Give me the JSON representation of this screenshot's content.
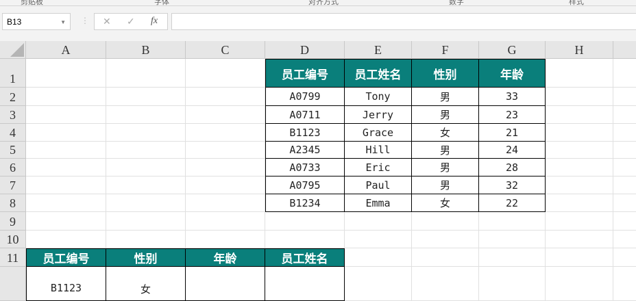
{
  "ribbon": {
    "groups": [
      "剪贴板",
      "字体",
      "对齐方式",
      "数字",
      "样式"
    ]
  },
  "formula_bar": {
    "name_box": "B13",
    "cancel": "✕",
    "confirm": "✓",
    "fx": "fx",
    "formula": ""
  },
  "columns": [
    "A",
    "B",
    "C",
    "D",
    "E",
    "F",
    "G",
    "H"
  ],
  "rows": [
    "1",
    "2",
    "3",
    "4",
    "5",
    "6",
    "7",
    "8",
    "9",
    "10",
    "11"
  ],
  "table1": {
    "headers": [
      "员工编号",
      "员工姓名",
      "性别",
      "年龄"
    ],
    "rows": [
      [
        "A0799",
        "Tony",
        "男",
        "33"
      ],
      [
        "A0711",
        "Jerry",
        "男",
        "23"
      ],
      [
        "B1123",
        "Grace",
        "女",
        "21"
      ],
      [
        "A2345",
        "Hill",
        "男",
        "24"
      ],
      [
        "A0733",
        "Eric",
        "男",
        "28"
      ],
      [
        "A0795",
        "Paul",
        "男",
        "32"
      ],
      [
        "B1234",
        "Emma",
        "女",
        "22"
      ]
    ]
  },
  "table2": {
    "headers": [
      "员工编号",
      "性别",
      "年龄",
      "员工姓名"
    ],
    "row": [
      "B1123",
      "女",
      "",
      ""
    ]
  },
  "colors": {
    "header_fill": "#0a7f7b"
  }
}
